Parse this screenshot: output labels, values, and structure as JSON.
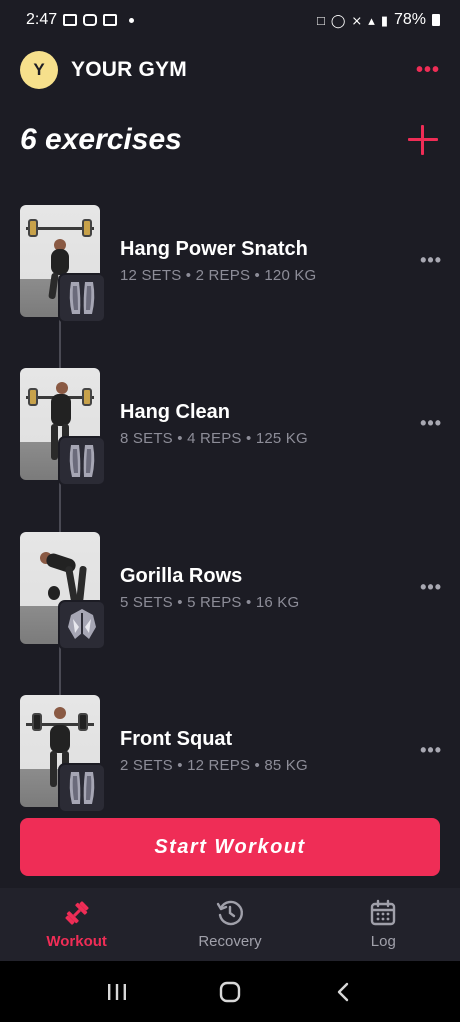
{
  "status_bar": {
    "time": "2:47",
    "battery": "78%"
  },
  "header": {
    "avatar_letter": "Y",
    "gym_name": "YOUR GYM",
    "more": "•••"
  },
  "title": {
    "count_label": "6 exercises"
  },
  "exercises": [
    {
      "name": "Hang Power Snatch",
      "meta": "12 SETS • 2 REPS • 120 KG",
      "muscle": "quads"
    },
    {
      "name": "Hang Clean",
      "meta": "8 SETS • 4 REPS • 125 KG",
      "muscle": "quads"
    },
    {
      "name": "Gorilla Rows",
      "meta": "5 SETS • 5 REPS • 16 KG",
      "muscle": "back"
    },
    {
      "name": "Front Squat",
      "meta": "2 SETS • 12 REPS • 85 KG",
      "muscle": "quads"
    }
  ],
  "item_more": "•••",
  "start_button": {
    "label": "Start Workout"
  },
  "tabs": [
    {
      "label": "Workout",
      "icon": "dumbbell-icon",
      "active": true
    },
    {
      "label": "Recovery",
      "icon": "recovery-clock-icon",
      "active": false
    },
    {
      "label": "Log",
      "icon": "calendar-icon",
      "active": false
    }
  ],
  "colors": {
    "accent": "#ef2d56",
    "background": "#1c1c24",
    "avatar": "#f6e08c",
    "muted": "#8d8d98"
  }
}
